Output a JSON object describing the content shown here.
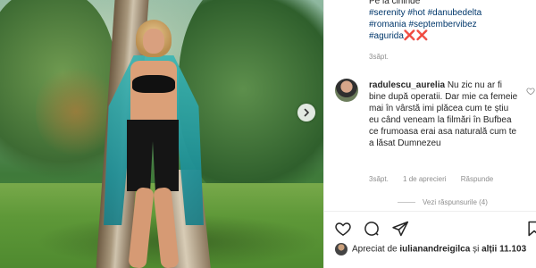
{
  "caption": {
    "line1": "Pe la cininde",
    "line2_tags": [
      "#serenity",
      "#hot",
      "#danubedelta"
    ],
    "line3_tags": [
      "#romania",
      "#septembervibez"
    ],
    "line4_tag": "#agurida",
    "line4_marks": "❌❌",
    "time": "3săpt."
  },
  "comment": {
    "username": "radulescu_aurelia",
    "text": "Nu zic nu ar fi bine după operatii. Dar mie ca femeie mai în vârstă imi plăcea cum te știu eu când veneam la filmări în Bufbea ce frumoasa erai asa naturală cum te a lăsat Dumnezeu",
    "time": "3săpt.",
    "likes": "1 de aprecieri",
    "reply": "Răspunde",
    "view_replies": "Vezi răspunsurile (4)"
  },
  "likes_bar": {
    "prefix": "Apreciat de",
    "user": "iulianandreigilca",
    "joiner": "și",
    "others": "alții 11.103"
  },
  "icons": {
    "like": "heart-icon",
    "comment": "comment-icon",
    "share": "paper-plane-icon",
    "save": "bookmark-icon",
    "next": "chevron-right-icon",
    "comment_like": "small-heart-icon"
  },
  "colors": {
    "hashtag": "#00376b",
    "muted": "#8e8e8e",
    "text": "#262626",
    "x_mark": "#c0392b"
  }
}
